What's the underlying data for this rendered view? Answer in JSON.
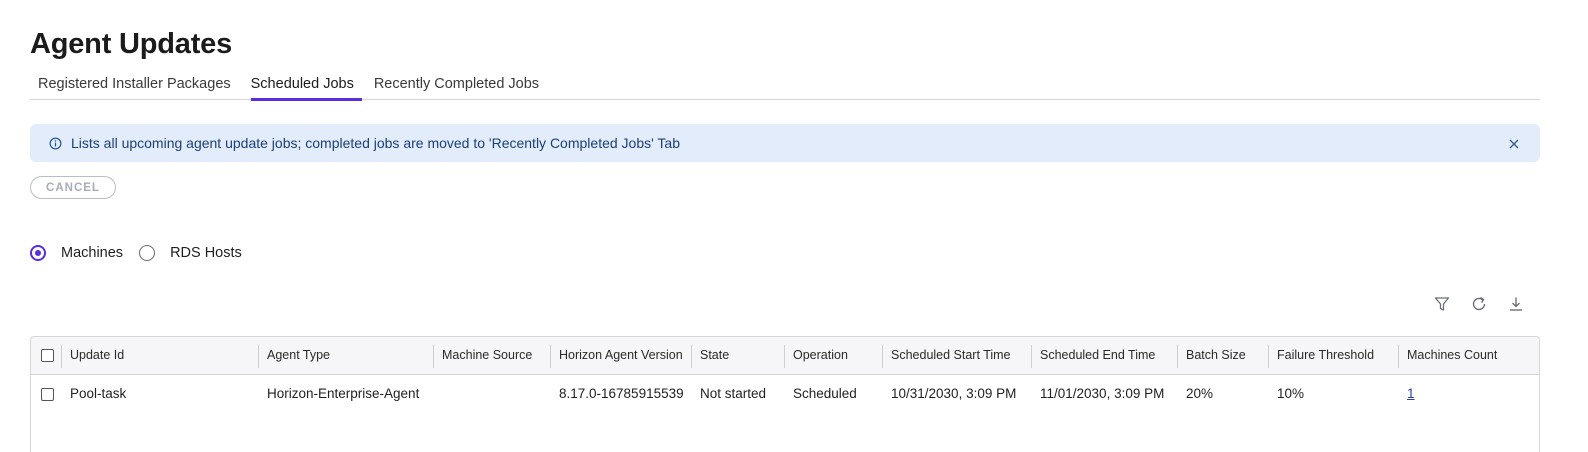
{
  "page": {
    "title": "Agent Updates"
  },
  "tabs": [
    {
      "label": "Registered Installer Packages",
      "active": false
    },
    {
      "label": "Scheduled Jobs",
      "active": true
    },
    {
      "label": "Recently Completed Jobs",
      "active": false
    }
  ],
  "banner": {
    "icon": "info-icon",
    "text": "Lists all upcoming agent update jobs; completed jobs are moved to 'Recently Completed Jobs' Tab",
    "close_icon": "close-icon"
  },
  "actions": {
    "cancel_label": "CANCEL"
  },
  "radio": {
    "options": [
      {
        "label": "Machines",
        "checked": true
      },
      {
        "label": "RDS Hosts",
        "checked": false
      }
    ]
  },
  "toolbar": {
    "icons": [
      "filter-icon",
      "refresh-icon",
      "download-icon"
    ]
  },
  "table": {
    "columns": [
      "Update Id",
      "Agent Type",
      "Machine Source",
      "Horizon Agent Version",
      "State",
      "Operation",
      "Scheduled Start Time",
      "Scheduled End Time",
      "Batch Size",
      "Failure Threshold",
      "Machines Count"
    ],
    "rows": [
      {
        "update_id": "Pool-task",
        "agent_type": "Horizon-Enterprise-Agent",
        "machine_source": "",
        "horizon_agent_version": "8.17.0-16785915539",
        "state": "Not started",
        "operation": "Scheduled",
        "scheduled_start_time": "10/31/2030, 3:09 PM",
        "scheduled_end_time": "11/01/2030, 3:09 PM",
        "batch_size": "20%",
        "failure_threshold": "10%",
        "machines_count": "1"
      }
    ]
  },
  "colors": {
    "accent": "#5b2de0",
    "banner_bg": "#e2ecfb",
    "link": "#2b3fa8"
  }
}
